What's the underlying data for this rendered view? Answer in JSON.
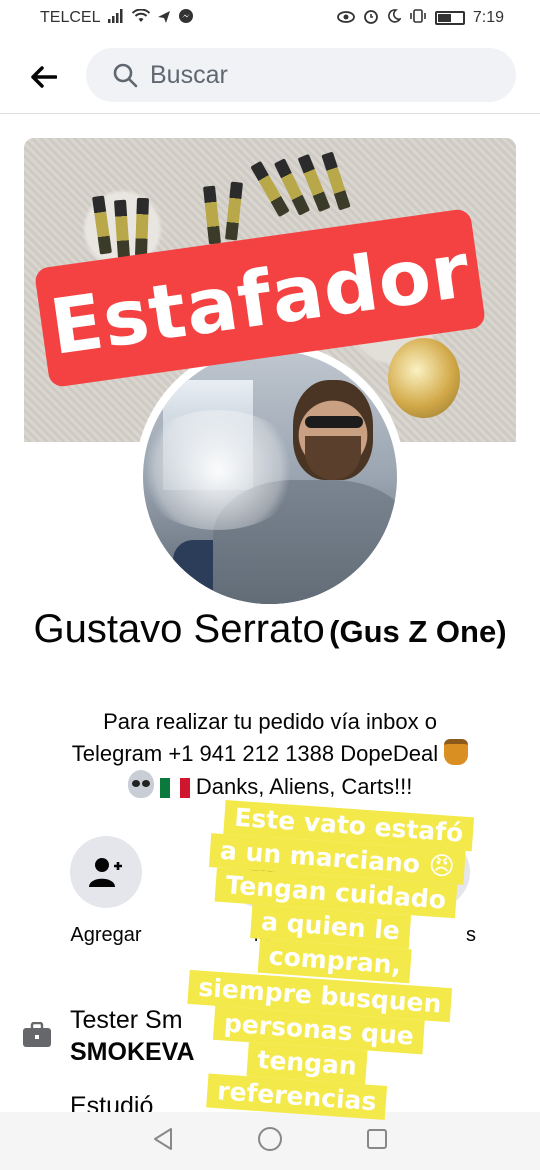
{
  "status_bar": {
    "carrier": "TELCEL",
    "time": "7:19",
    "battery_level": 0.55,
    "icons": [
      "signal-icon",
      "wifi-icon",
      "send-icon",
      "messenger-icon",
      "eye-icon",
      "alarm-icon",
      "moon-icon",
      "vibrate-icon",
      "battery-icon"
    ]
  },
  "header": {
    "back_icon": "arrow-left-icon",
    "search_placeholder": "Buscar"
  },
  "cover": {
    "overlay_label": "Estafador"
  },
  "profile": {
    "name": "Gustavo Serrato",
    "alternate_name": "(Gus Z One)",
    "bio_line1": "Para realizar tu pedido vía inbox o",
    "bio_line2": "Telegram +1 941 212 1388 DopeDeal",
    "bio_line3": "Danks, Aliens, Carts!!!"
  },
  "actions": [
    {
      "label": "Agregar",
      "icon": "add-friend-icon"
    },
    {
      "label": "M",
      "icon": "message-icon"
    },
    {
      "label": "s",
      "icon": "more-icon"
    }
  ],
  "info": {
    "work_line1": "Tester Sm",
    "work_line2": "SMOKEVA",
    "education_partial": "Estudió"
  },
  "sticker": {
    "lines": [
      "Este vato estafó",
      "a un marciano 😠",
      "Tengan cuidado",
      "a quien le",
      "compran,",
      "siempre busquen",
      "personas que",
      "tengan",
      "referencias"
    ]
  },
  "colors": {
    "label_red": "#f44242",
    "sticker_yellow": "#f4e94a",
    "action_bg": "#e4e6eb",
    "search_bg": "#f0f2f5"
  }
}
